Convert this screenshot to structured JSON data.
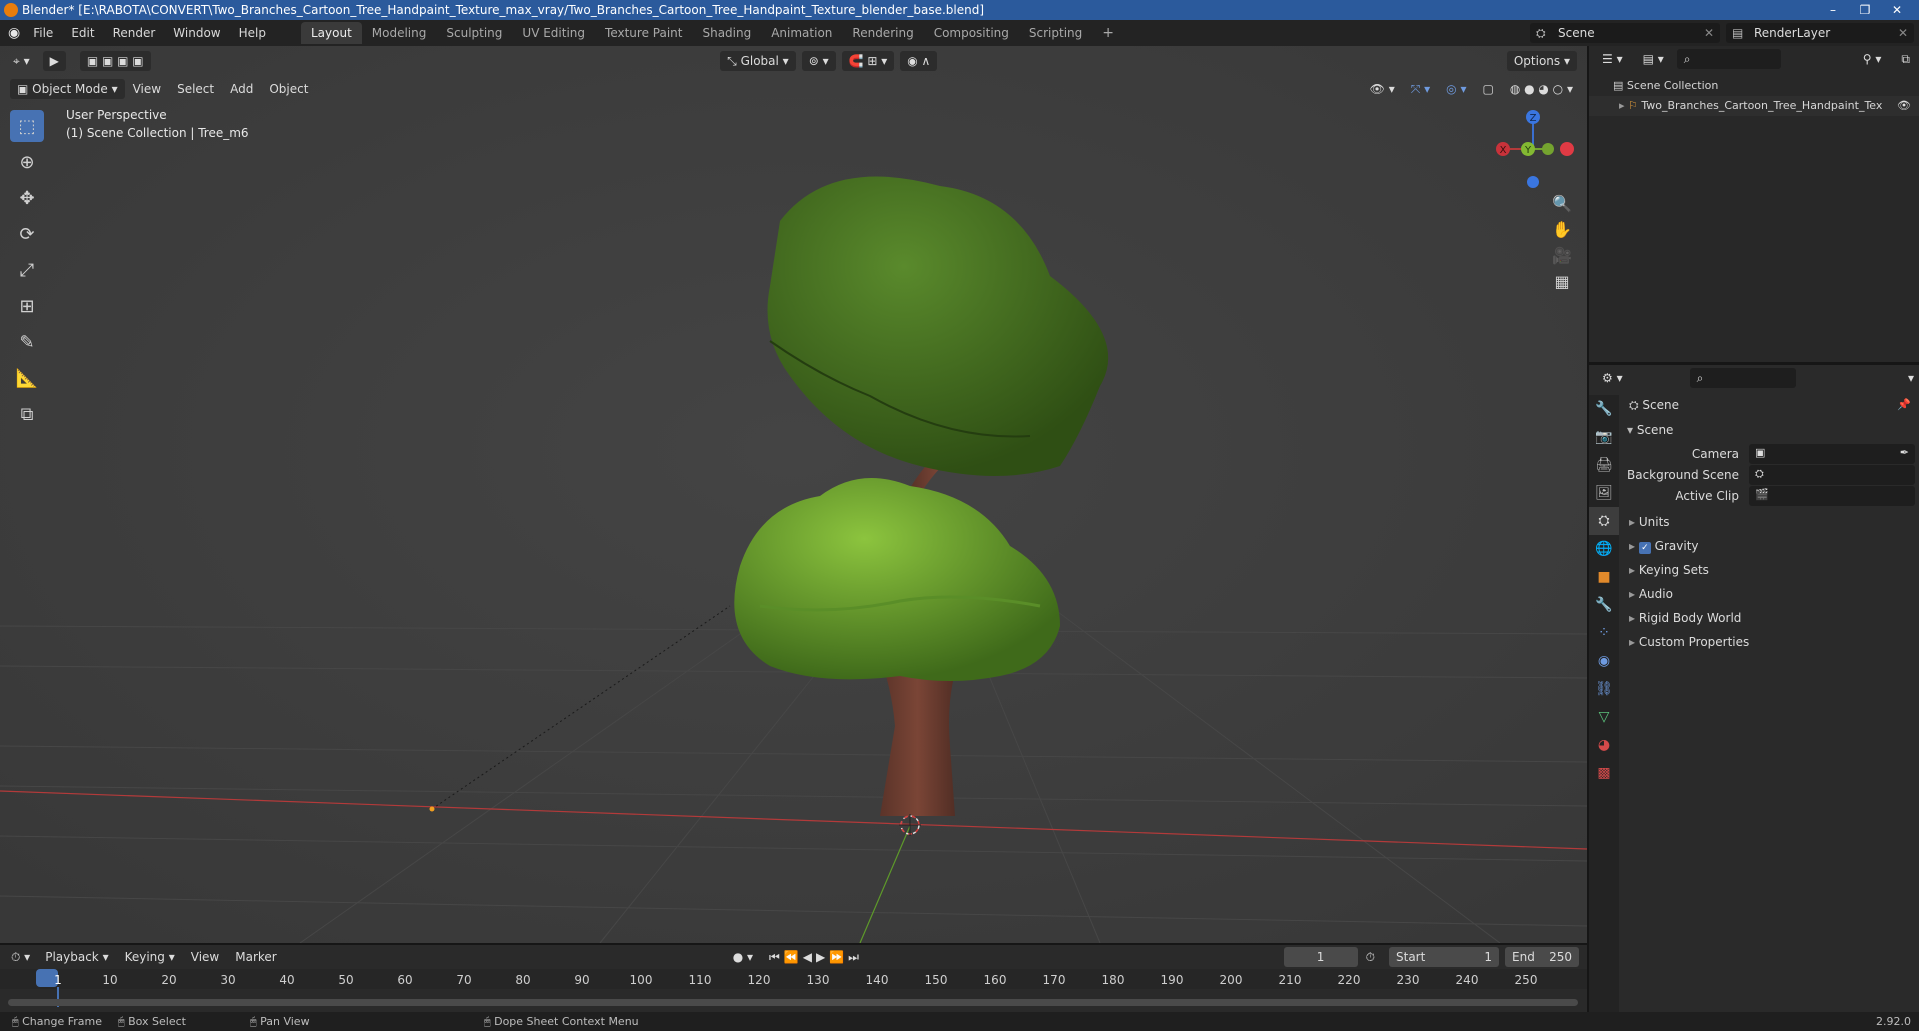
{
  "window": {
    "title": "Blender* [E:\\RABOTA\\CONVERT\\Two_Branches_Cartoon_Tree_Handpaint_Texture_max_vray/Two_Branches_Cartoon_Tree_Handpaint_Texture_blender_base.blend]",
    "controls": [
      "–",
      "❐",
      "✕"
    ]
  },
  "menu": [
    "File",
    "Edit",
    "Render",
    "Window",
    "Help"
  ],
  "workspaces": [
    "Layout",
    "Modeling",
    "Sculpting",
    "UV Editing",
    "Texture Paint",
    "Shading",
    "Animation",
    "Rendering",
    "Compositing",
    "Scripting"
  ],
  "add_workspace": "+",
  "scene_name": "Scene",
  "render_layer": "RenderLayer",
  "viewport": {
    "transform_orientation": "Global",
    "options_label": "Options",
    "mode": "Object Mode",
    "header_menus": [
      "View",
      "Select",
      "Add",
      "Object"
    ],
    "info_line1": "User Perspective",
    "info_line2": "(1) Scene Collection | Tree_m6",
    "gizmo": {
      "z": "Z",
      "y": "Y",
      "x": "X"
    }
  },
  "outliner": {
    "root": "Scene Collection",
    "item": "Two_Branches_Cartoon_Tree_Handpaint_Tex"
  },
  "properties": {
    "context": "Scene",
    "panel": "Scene",
    "camera_label": "Camera",
    "background_scene_label": "Background Scene",
    "active_clip_label": "Active Clip",
    "sections": [
      "Units",
      "Gravity",
      "Keying Sets",
      "Audio",
      "Rigid Body World",
      "Custom Properties"
    ],
    "gravity_checked": true
  },
  "timeline": {
    "menus": [
      "Playback",
      "Keying",
      "View",
      "Marker"
    ],
    "current_frame": "1",
    "start_label": "Start",
    "start": "1",
    "end_label": "End",
    "end": "250",
    "ruler": [
      "1",
      "10",
      "20",
      "30",
      "40",
      "50",
      "60",
      "70",
      "80",
      "90",
      "100",
      "110",
      "120",
      "130",
      "140",
      "150",
      "160",
      "170",
      "180",
      "190",
      "200",
      "210",
      "220",
      "230",
      "240",
      "250"
    ]
  },
  "statusbar": {
    "items": [
      "Change Frame",
      "Box Select",
      "Pan View",
      "Dope Sheet Context Menu"
    ],
    "version": "2.92.0"
  }
}
